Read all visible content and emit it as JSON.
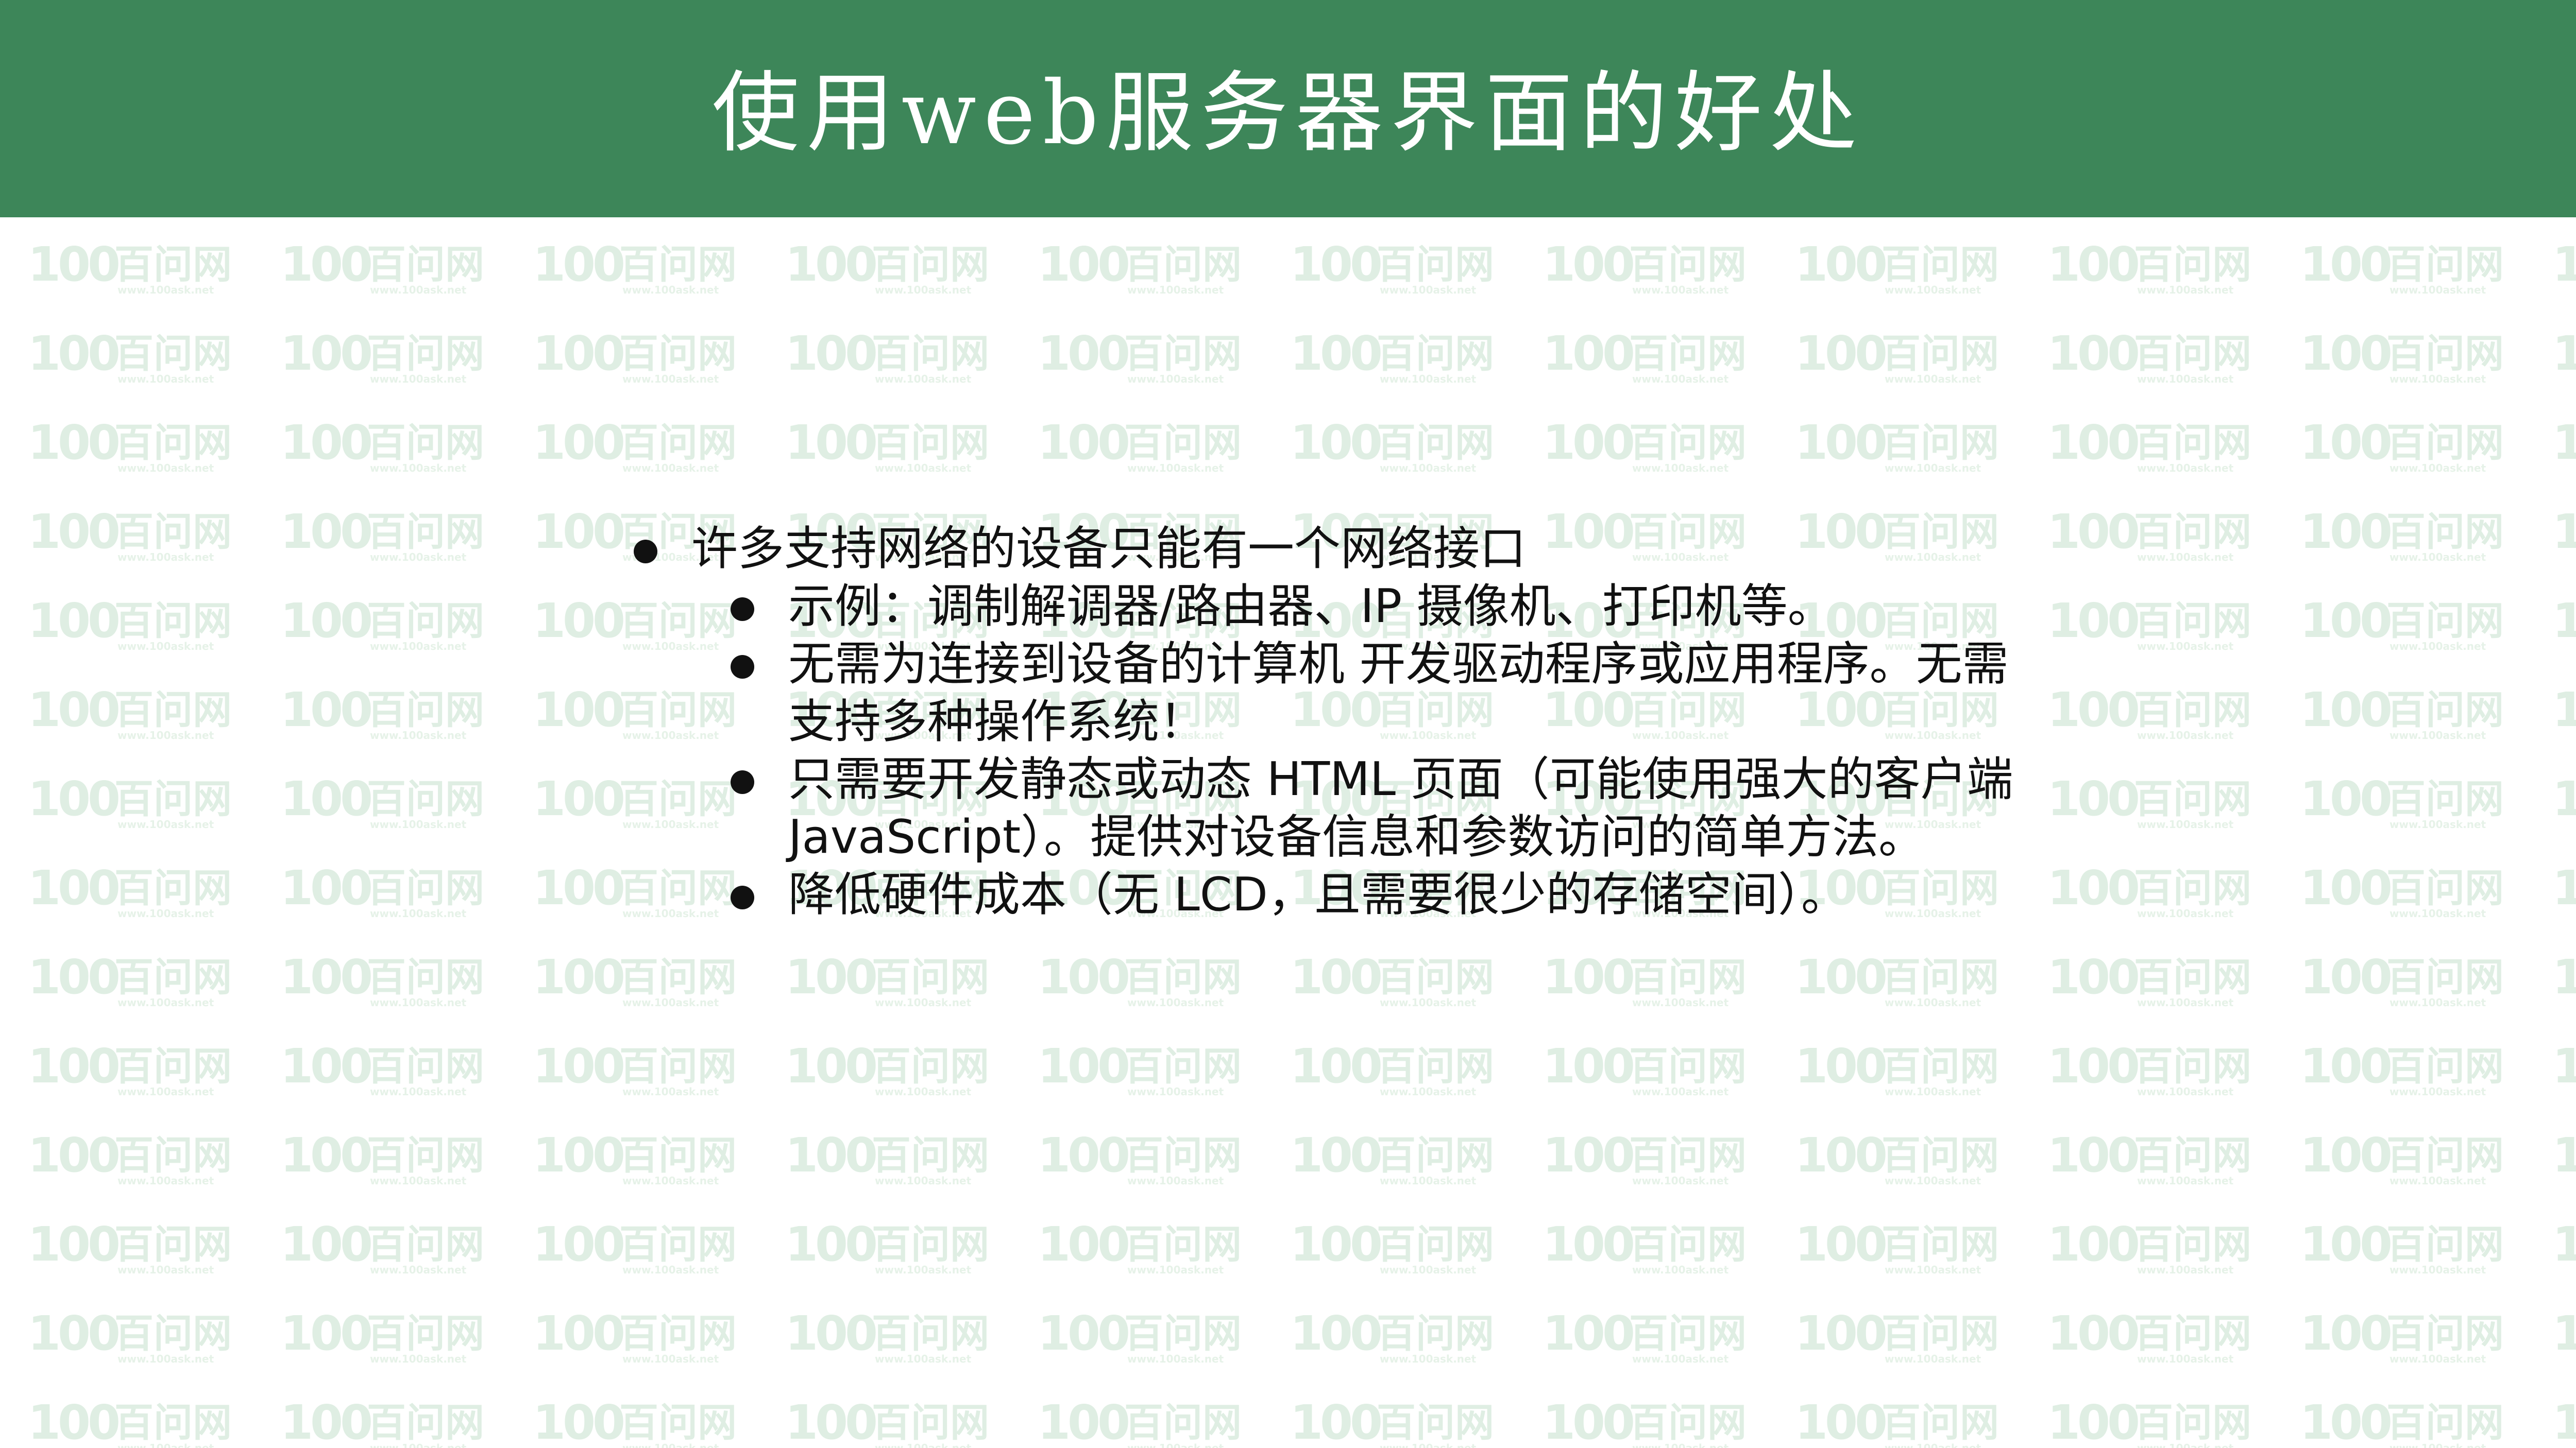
{
  "slide": {
    "title": "使用web服务器界面的好处",
    "colors": {
      "title_bar": "#3d8659",
      "title_text": "#ffffff",
      "body_text": "#111111",
      "watermark": "#d9ebdd"
    },
    "watermark": {
      "logo_text": "100",
      "brand_text": "百问网",
      "url_text": "www.100ask.net"
    },
    "bullets": [
      {
        "text": "许多支持网络的设备只能有一个网络接口",
        "children": [
          {
            "text": "示例：调制解调器/路由器、IP 摄像机、打印机等。"
          },
          {
            "text": "无需为连接到设备的计算机 开发驱动程序或应用程序。无需支持多种操作系统！"
          },
          {
            "text": "只需要开发静态或动态 HTML 页面（可能使用强大的客户端 JavaScript）。提供对设备信息和参数访问的简单方法。"
          },
          {
            "text": "降低硬件成本（无 LCD，且需要很少的存储空间）。"
          }
        ]
      }
    ]
  }
}
